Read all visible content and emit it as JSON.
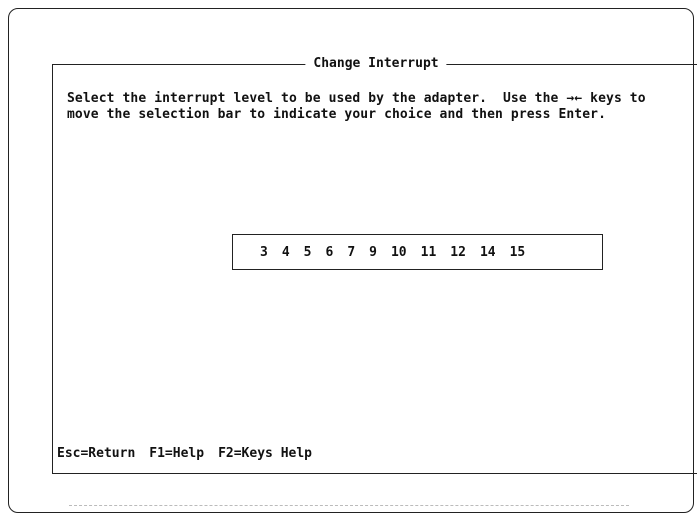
{
  "window": {
    "title": "Change Interrupt"
  },
  "instructions": {
    "line1": "Select the interrupt level to be used by the adapter.  Use the →← keys to",
    "line2": "move the selection bar to indicate your choice and then press Enter."
  },
  "interrupt_levels": [
    "3",
    "4",
    "5",
    "6",
    "7",
    "9",
    "10",
    "11",
    "12",
    "14",
    "15"
  ],
  "footer": {
    "esc": "Esc=Return",
    "f1": "F1=Help",
    "f2": "F2=Keys Help"
  }
}
